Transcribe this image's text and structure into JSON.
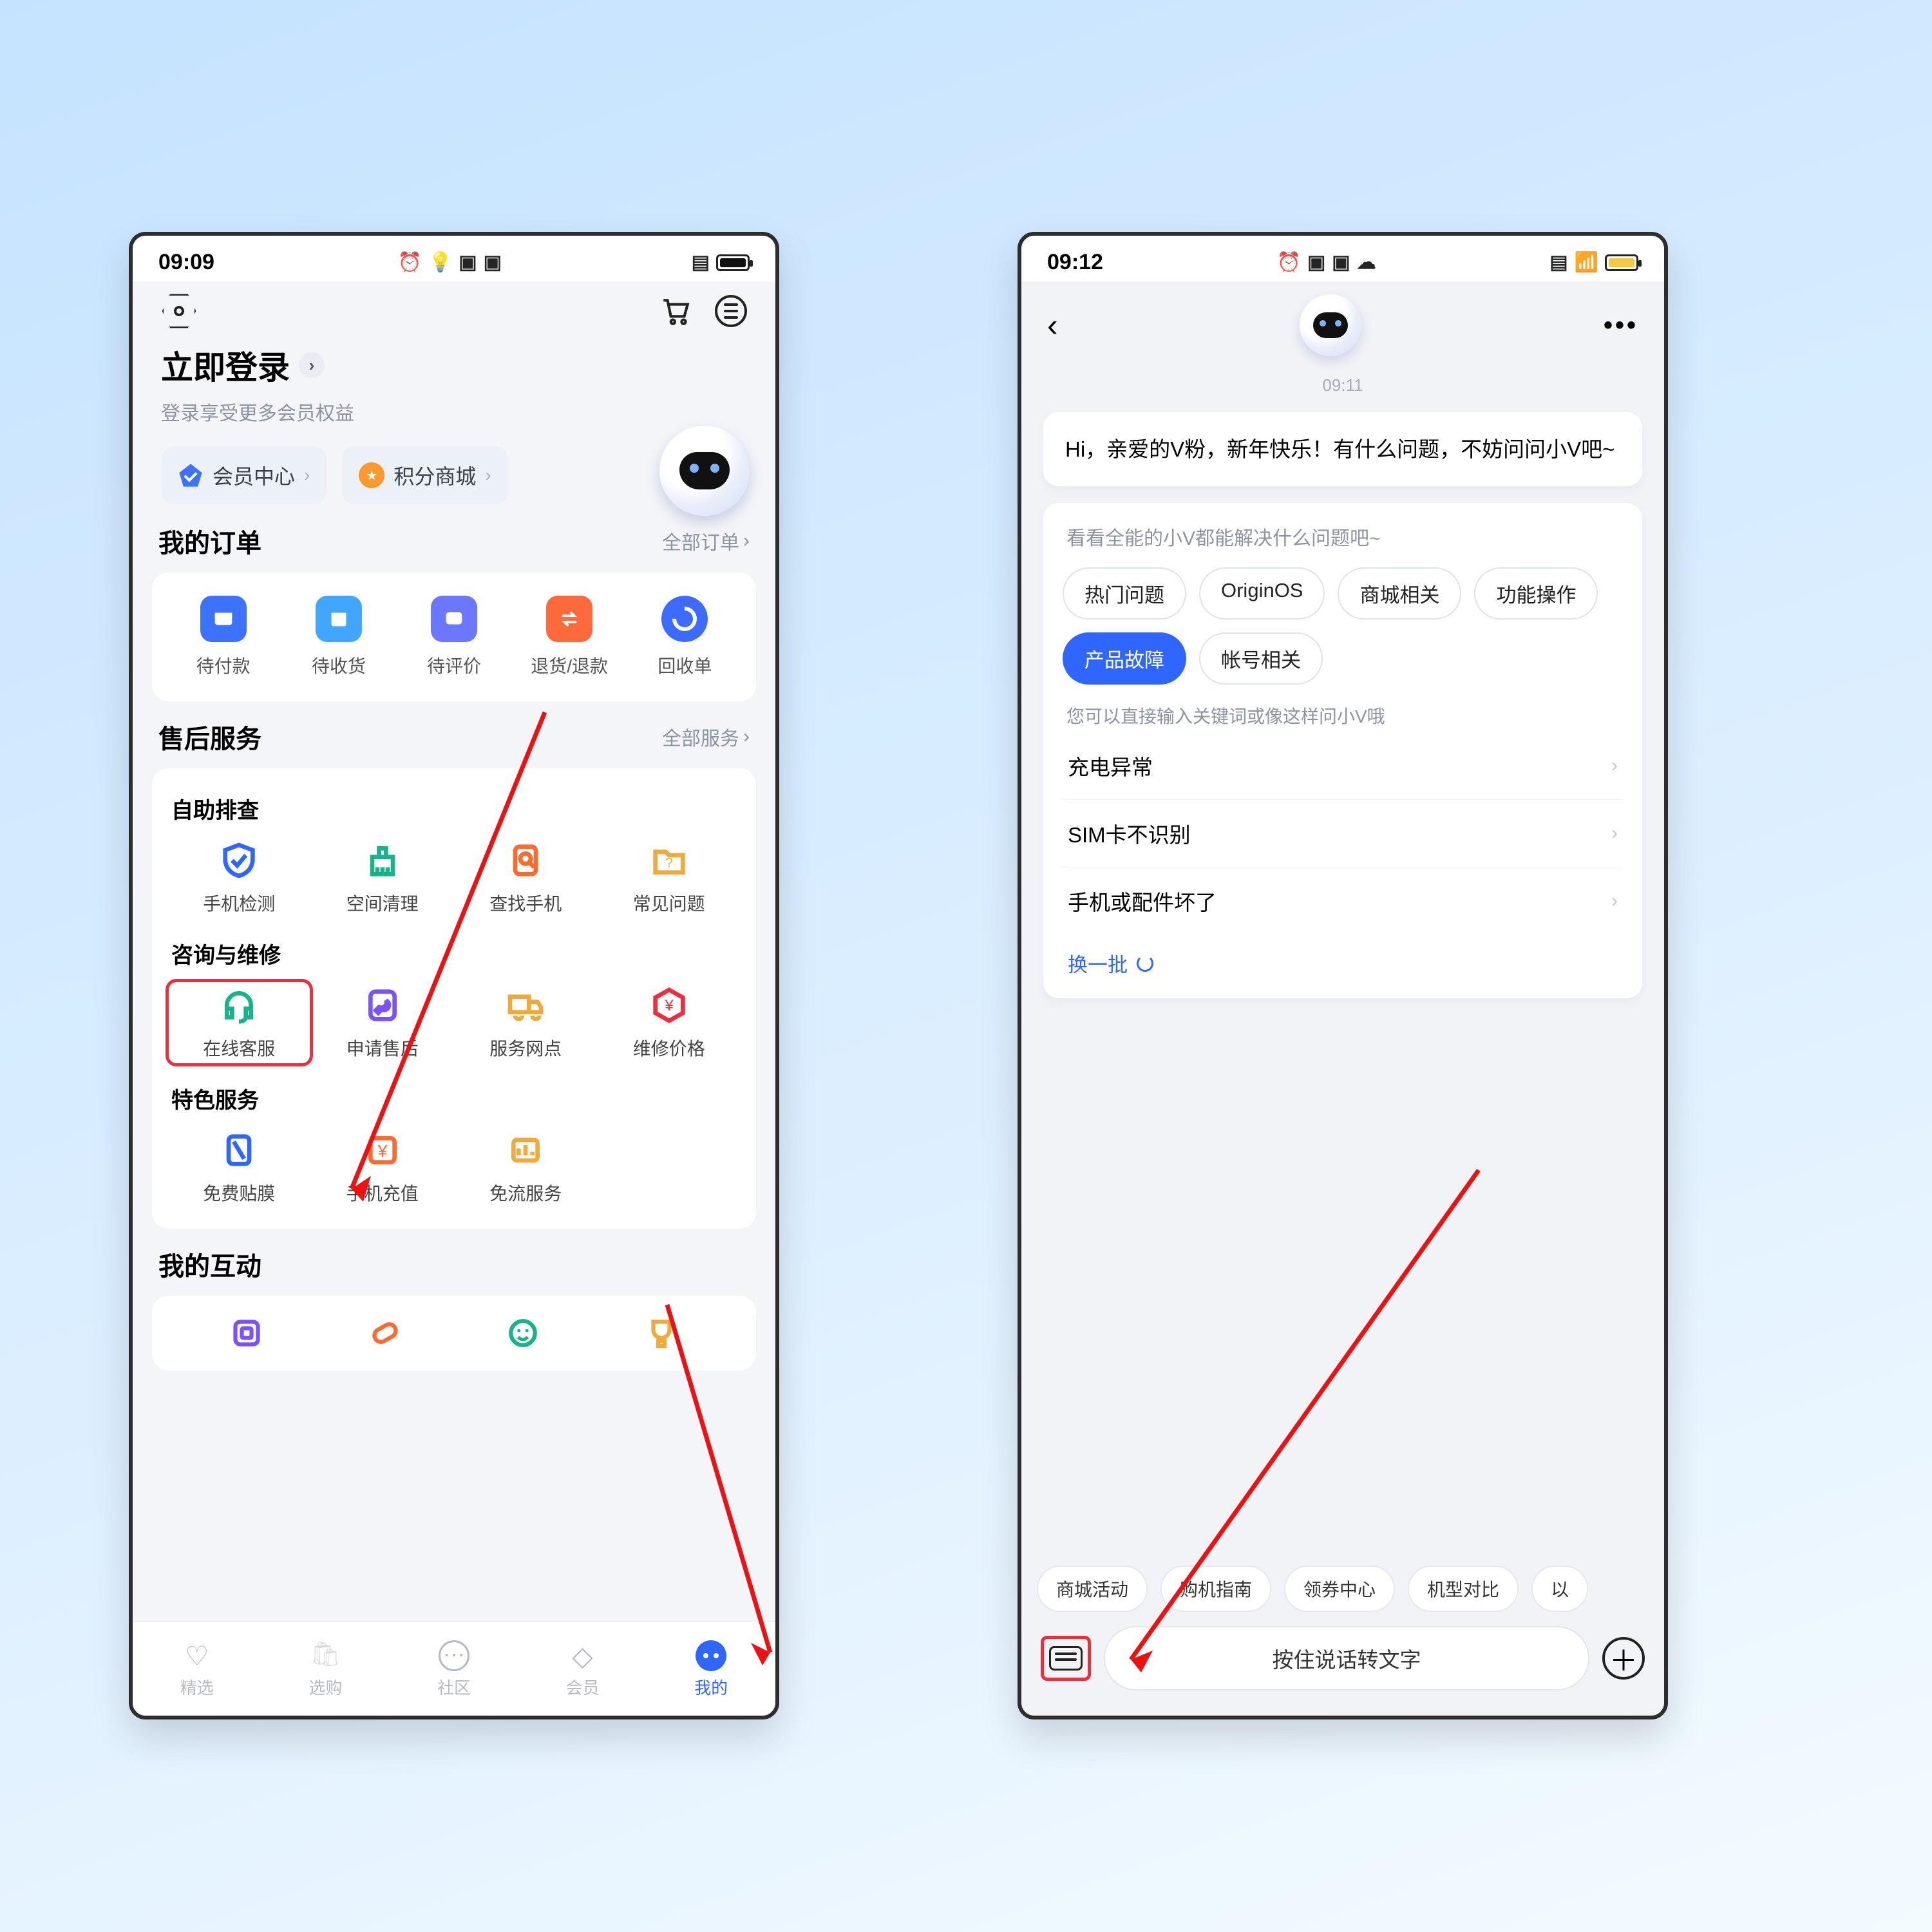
{
  "left": {
    "status_time": "09:09",
    "login_title": "立即登录",
    "login_sub": "登录享受更多会员权益",
    "pills": {
      "member": "会员中心",
      "points": "积分商城"
    },
    "orders": {
      "header": "我的订单",
      "all": "全部订单",
      "items": [
        "待付款",
        "待收货",
        "待评价",
        "退货/退款",
        "回收单"
      ]
    },
    "service": {
      "header": "售后服务",
      "all": "全部服务",
      "g1_title": "自助排查",
      "g1": [
        "手机检测",
        "空间清理",
        "查找手机",
        "常见问题"
      ],
      "g2_title": "咨询与维修",
      "g2": [
        "在线客服",
        "申请售后",
        "服务网点",
        "维修价格"
      ],
      "g3_title": "特色服务",
      "g3": [
        "免费贴膜",
        "手机充值",
        "免流服务"
      ]
    },
    "interact_header": "我的互动",
    "tabs": [
      "精选",
      "选购",
      "社区",
      "会员",
      "我的"
    ]
  },
  "right": {
    "status_time": "09:12",
    "time_label": "09:11",
    "greeting": "Hi，亲爱的V粉，新年快乐！有什么问题，不妨问问小V吧~",
    "panel_hint": "看看全能的小V都能解决什么问题吧~",
    "chips": [
      "热门问题",
      "OriginOS",
      "商城相关",
      "功能操作",
      "产品故障",
      "帐号相关"
    ],
    "sub_hint": "您可以直接输入关键词或像这样问小V哦",
    "questions": [
      "充电异常",
      "SIM卡不识别",
      "手机或配件坏了"
    ],
    "refresh": "换一批",
    "suggest": [
      "商城活动",
      "购机指南",
      "领券中心",
      "机型对比",
      "以"
    ],
    "talk_placeholder": "按住说话转文字"
  }
}
